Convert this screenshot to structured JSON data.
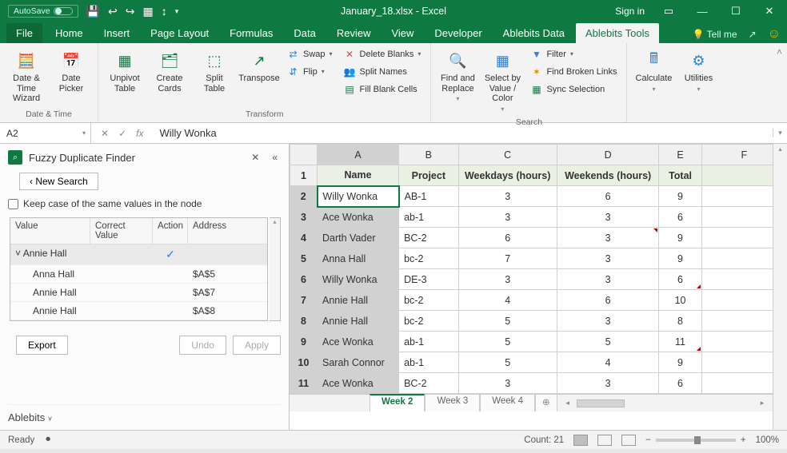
{
  "titlebar": {
    "autosave_label": "AutoSave",
    "title": "January_18.xlsx  -  Excel",
    "signin": "Sign in"
  },
  "tabs": {
    "file": "File",
    "items": [
      "Home",
      "Insert",
      "Page Layout",
      "Formulas",
      "Data",
      "Review",
      "View",
      "Developer",
      "Ablebits Data",
      "Ablebits Tools"
    ],
    "active_index": 9,
    "tell_me": "Tell me"
  },
  "ribbon": {
    "groups": {
      "datetime": {
        "label": "Date & Time",
        "date_time_wizard": "Date & Time Wizard",
        "date_picker": "Date Picker"
      },
      "transform": {
        "label": "Transform",
        "unpivot": "Unpivot Table",
        "create_cards": "Create Cards",
        "split_table": "Split Table",
        "transpose": "Transpose",
        "swap": "Swap",
        "flip": "Flip",
        "delete_blanks": "Delete Blanks",
        "split_names": "Split Names",
        "fill_blanks": "Fill Blank Cells"
      },
      "search": {
        "label": "Search",
        "find_replace": "Find and Replace",
        "select_by": "Select by Value / Color",
        "filter": "Filter",
        "find_broken": "Find Broken Links",
        "sync_sel": "Sync Selection"
      },
      "tools": {
        "calculate": "Calculate",
        "utilities": "Utilities"
      }
    }
  },
  "formula_bar": {
    "cell_ref": "A2",
    "value": "Willy Wonka"
  },
  "pane": {
    "title": "Fuzzy Duplicate Finder",
    "new_search": "New Search",
    "keep_case": "Keep case of the same values in the node",
    "columns": {
      "value": "Value",
      "correct": "Correct Value",
      "action": "Action",
      "address": "Address"
    },
    "root": "Annie Hall",
    "rows": [
      {
        "value": "Anna Hall",
        "address": "$A$5"
      },
      {
        "value": "Annie Hall",
        "address": "$A$7"
      },
      {
        "value": "Annie Hall",
        "address": "$A$8"
      }
    ],
    "buttons": {
      "export": "Export",
      "undo": "Undo",
      "apply": "Apply"
    },
    "footer": "Ablebits"
  },
  "sheet": {
    "col_letters": [
      "A",
      "B",
      "C",
      "D",
      "E",
      "F"
    ],
    "headers": [
      "Name",
      "Project",
      "Weekdays (hours)",
      "Weekends (hours)",
      "Total"
    ],
    "rows": [
      {
        "n": 2,
        "name": "Willy Wonka",
        "proj": "AB-1",
        "wd": "3",
        "we": "6",
        "tot": "9"
      },
      {
        "n": 3,
        "name": "Ace Wonka",
        "proj": "ab-1",
        "wd": "3",
        "we": "3",
        "tot": "6"
      },
      {
        "n": 4,
        "name": "Darth Vader",
        "proj": "BC-2",
        "wd": "6",
        "we": "3",
        "tot": "9"
      },
      {
        "n": 5,
        "name": "Anna Hall",
        "proj": "bc-2",
        "wd": "7",
        "we": "3",
        "tot": "9"
      },
      {
        "n": 6,
        "name": "Willy Wonka",
        "proj": "DE-3",
        "wd": "3",
        "we": "3",
        "tot": "6"
      },
      {
        "n": 7,
        "name": "Annie Hall",
        "proj": "bc-2",
        "wd": "4",
        "we": "6",
        "tot": "10"
      },
      {
        "n": 8,
        "name": "Annie Hall",
        "proj": "bc-2",
        "wd": "5",
        "we": "3",
        "tot": "8"
      },
      {
        "n": 9,
        "name": "Ace Wonka",
        "proj": "ab-1",
        "wd": "5",
        "we": "5",
        "tot": "11"
      },
      {
        "n": 10,
        "name": "Sarah Connor",
        "proj": "ab-1",
        "wd": "5",
        "we": "4",
        "tot": "9"
      },
      {
        "n": 11,
        "name": "Ace Wonka",
        "proj": "BC-2",
        "wd": "3",
        "we": "3",
        "tot": "6"
      }
    ],
    "tabs": [
      "Week 2",
      "Week 3",
      "Week 4"
    ],
    "active_tab": 0
  },
  "status": {
    "ready": "Ready",
    "count": "Count: 21",
    "zoom": "100%"
  }
}
